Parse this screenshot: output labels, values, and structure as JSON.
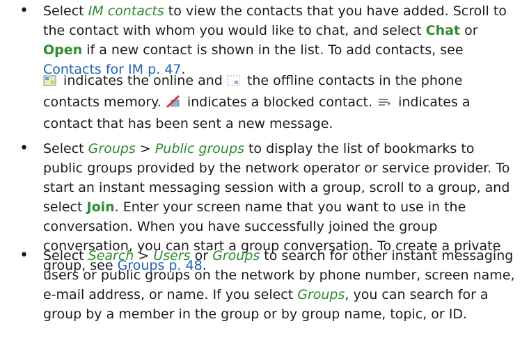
{
  "bullet1": {
    "t1": "Select ",
    "im_contacts": "IM contacts",
    "t2": " to view the contacts that you have added. Scroll to the contact with whom you would like to chat, and select ",
    "chat": "Chat",
    "t3": " or ",
    "open": "Open",
    "t4": " if a new contact is shown in the list. To add contacts, see ",
    "link": "Contacts for IM",
    "t5": " ",
    "page_ref": "p. 47",
    "t6": "."
  },
  "icons_para": {
    "t1": " indicates the online and ",
    "t2": " the offline contacts in the phone contacts memory. ",
    "t3": " indicates a blocked contact. ",
    "t4": " indicates a contact that has been sent a new message.",
    "icons": [
      "online-contact-icon",
      "offline-contact-icon",
      "blocked-contact-icon",
      "new-message-icon"
    ]
  },
  "bullet2": {
    "t1": "Select ",
    "groups": "Groups",
    "t2": " > ",
    "public_groups": "Public groups",
    "t3": " to display the list of bookmarks to public groups provided by the network operator or service provider. To start an instant messaging session with a group, scroll to a group, and select ",
    "join": "Join",
    "t4": ". Enter your screen name that you want to use in the conversation. When you have successfully joined the group conversation, you can start a group conversation. To create a private group, see ",
    "link": "Groups",
    "t5": " ",
    "page_ref": "p. 48",
    "t6": "."
  },
  "bullet3": {
    "t1": "Select ",
    "search": "Search",
    "t2": " > ",
    "users": "Users",
    "t3": " or ",
    "groups": "Groups",
    "t4": " to search for other instant messaging users or public groups on the network by phone number, screen name, e-mail address, or name. If you select ",
    "groups2": "Groups",
    "t5": ", you can search for a group by a member in the group or by group name, topic, or ID."
  },
  "colors": {
    "emphasis": "#2e8b2e",
    "link": "#1f5fb5",
    "text": "#1a1a1a"
  }
}
